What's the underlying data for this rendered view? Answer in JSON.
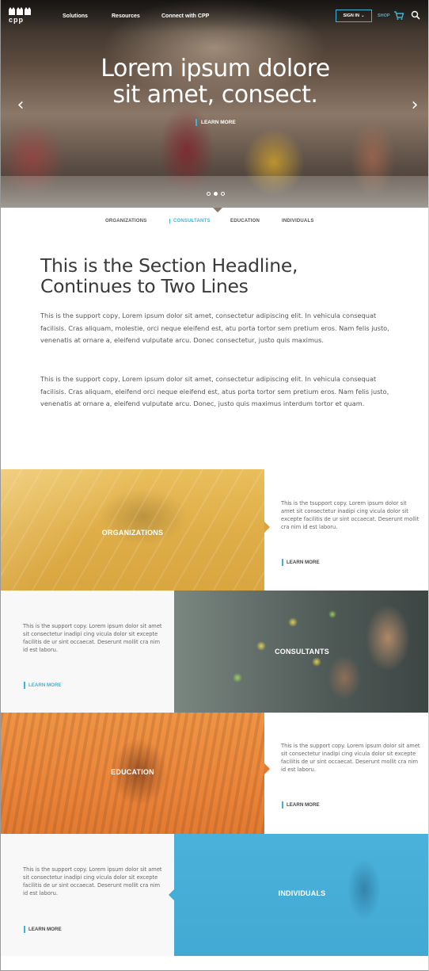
{
  "nav": {
    "logo_text": "cpp",
    "links": [
      "Solutions",
      "Resources",
      "Connect with CPP"
    ],
    "sign_in": "SIGN IN",
    "sign_in_caret": "⌄",
    "shop": "SHOP"
  },
  "hero": {
    "headline_line1": "Lorem ipsum dolore",
    "headline_line2": "sit amet, consect.",
    "cta": "LEARN MORE",
    "prev_arrow": "‹",
    "next_arrow": "›",
    "slides": 3,
    "active_slide": 2
  },
  "tabs": {
    "items": [
      "ORGANIZATIONS",
      "CONSULTANTS",
      "EDUCATION",
      "INDIVIDUALS"
    ],
    "active": "CONSULTANTS"
  },
  "section": {
    "headline_line1": "This is the Section Headline,",
    "headline_line2": "Continues to Two Lines",
    "para1": "This is the support copy, Lorem ipsum dolor sit amet, consectetur adipiscing elit. In vehicula consequat facilisis. Cras aliquam, molestie, orci neque eleifend est, atu porta tortor sem pretium eros. Nam felis justo, venenatis at ornare a, eleifend vulputate arcu. Donec consectetur, justo quis maximus.",
    "para2": "This is the support copy, Lorem ipsum dolor sit amet, consectetur adipiscing elit. In vehicula consequat facilisis. Cras aliquam, eleifend orci neque eleifend est, atus porta tortor sem pretium eros. Nam felis justo, venenatis at ornare a, eleifend vulputate arcu. Donec, justo quis maximus interdum tortor et quam."
  },
  "blocks": [
    {
      "label": "ORGANIZATIONS",
      "copy": "This is the tsupport copy. Lorem ipsum dolor sit amet sit consectetur inadipi cing vicula dolor sit excepte facilitis de ur sint occaecat. Deserunt mollit cra nim id est laboru.",
      "cta": "LEARN MORE",
      "color": "#e8b44a"
    },
    {
      "label": "CONSULTANTS",
      "copy": "This is the support copy. Lorem ipsum dolor sit amet sit consectetur inadipi cing vicula dolor sit excepte facilitis de ur sint occaecat. Deserunt mollit cra nim id est laboru.",
      "cta": "LEARN MORE",
      "color": "#6a7a6a"
    },
    {
      "label": "EDUCATION",
      "copy": "This is the support copy. Lorem ipsum dolor sit amet sit consectetur inadipi cing vicula dolor sit excepte facilitis de ur sint occaecat. Deserunt mollit cra nim id est laboru.",
      "cta": "LEARN MORE",
      "color": "#ee8a3c"
    },
    {
      "label": "INDIVIDUALS",
      "copy": "This is the support copy. Lorem ipsum dolor sit amet sit consectetur inadipi cing vicula dolor sit excepte facilitis de ur sint occaecat. Deserunt mollit cra nim id est laboru.",
      "cta": "LEARN MORE",
      "color": "#45acd6"
    }
  ],
  "colors": {
    "accent": "#3fb3d2"
  }
}
